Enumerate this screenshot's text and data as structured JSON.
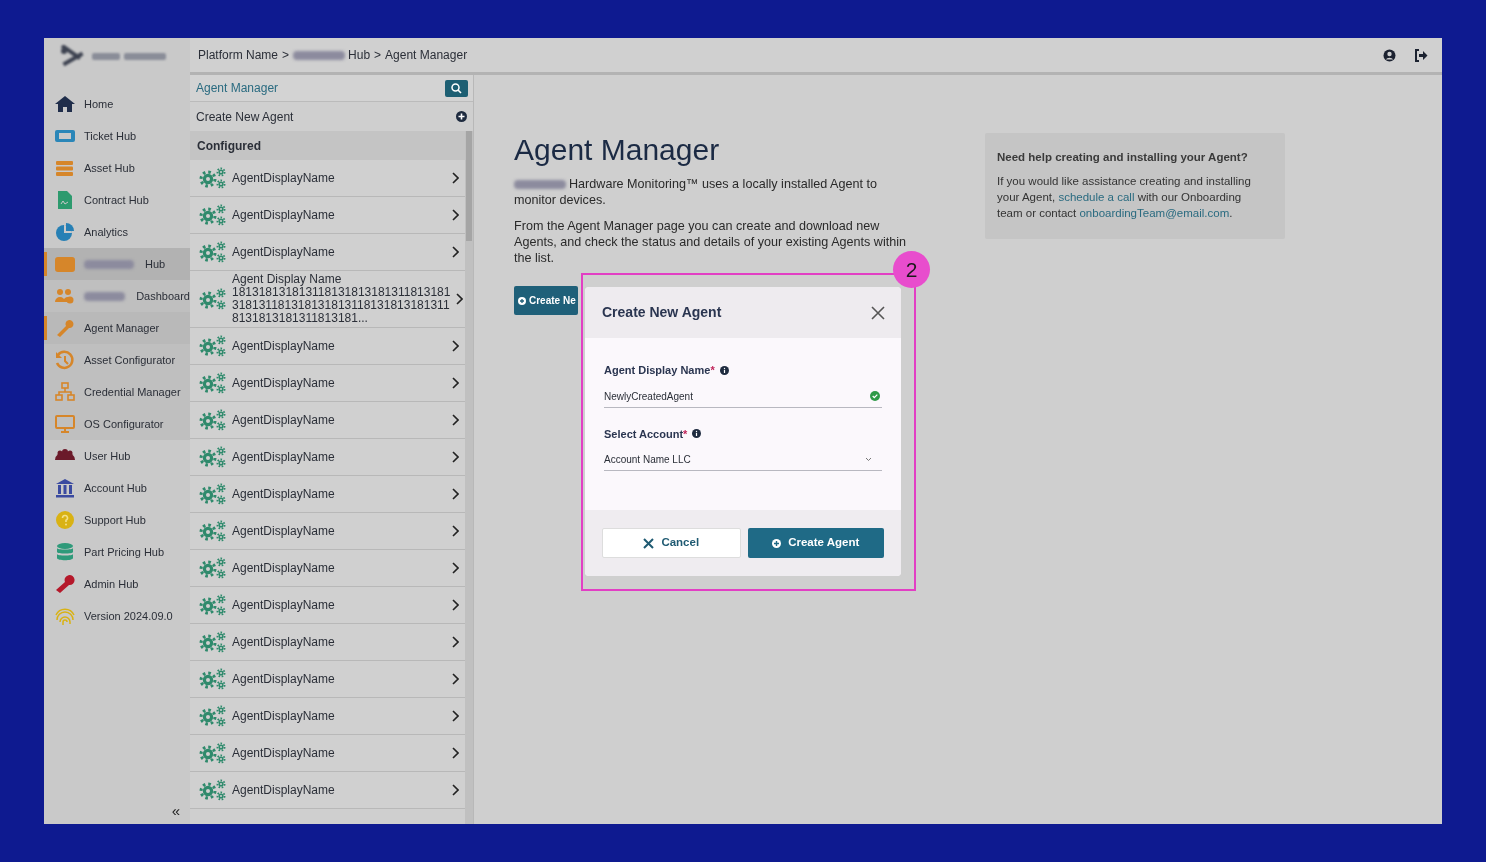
{
  "breadcrumb": {
    "separator": ">",
    "items": [
      {
        "text": "Platform Name",
        "redacted": false
      },
      {
        "text": "Hub",
        "redacted": true
      },
      {
        "text": "Agent Manager",
        "redacted": false
      }
    ]
  },
  "sidebar": {
    "items": [
      {
        "label": "Home",
        "selected": false,
        "redacted": false
      },
      {
        "label": "Ticket Hub",
        "selected": false,
        "redacted": false
      },
      {
        "label": "Asset Hub",
        "selected": false,
        "redacted": false
      },
      {
        "label": "Contract Hub",
        "selected": false,
        "redacted": false
      },
      {
        "label": "Analytics",
        "selected": false,
        "redacted": false
      },
      {
        "label": "Hub",
        "selected": true,
        "redacted": true,
        "children": [
          {
            "label": "Dashboard",
            "selected": false,
            "redacted": true
          },
          {
            "label": "Agent Manager",
            "selected": true,
            "redacted": false
          },
          {
            "label": "Asset Configurator",
            "selected": false,
            "redacted": false
          },
          {
            "label": "Credential Manager",
            "selected": false,
            "redacted": false
          },
          {
            "label": "OS Configurator",
            "selected": false,
            "redacted": false
          }
        ]
      },
      {
        "label": "User Hub",
        "selected": false,
        "redacted": false
      },
      {
        "label": "Account Hub",
        "selected": false,
        "redacted": false
      },
      {
        "label": "Support Hub",
        "selected": false,
        "redacted": false
      },
      {
        "label": "Part Pricing Hub",
        "selected": false,
        "redacted": false
      },
      {
        "label": "Admin Hub",
        "selected": false,
        "redacted": false
      },
      {
        "label": "Version 2024.09.0",
        "selected": false,
        "redacted": false
      }
    ],
    "collapse": "«"
  },
  "agent_list": {
    "search_label": "Agent Manager",
    "create_label": "Create New Agent",
    "section": "Configured",
    "rows": [
      {
        "name": "AgentDisplayName"
      },
      {
        "name": "AgentDisplayName"
      },
      {
        "name": "AgentDisplayName"
      },
      {
        "name": "Agent Display Name\n181318131813118131813181311813181\n318131181318131813118131813181311\n8131813181311813181..."
      },
      {
        "name": "AgentDisplayName"
      },
      {
        "name": "AgentDisplayName"
      },
      {
        "name": "AgentDisplayName"
      },
      {
        "name": "AgentDisplayName"
      },
      {
        "name": "AgentDisplayName"
      },
      {
        "name": "AgentDisplayName"
      },
      {
        "name": "AgentDisplayName"
      },
      {
        "name": "AgentDisplayName"
      },
      {
        "name": "AgentDisplayName"
      },
      {
        "name": "AgentDisplayName"
      },
      {
        "name": "AgentDisplayName"
      },
      {
        "name": "AgentDisplayName"
      },
      {
        "name": "AgentDisplayName"
      }
    ]
  },
  "intro": {
    "title": "Agent Manager",
    "paragraphs": [
      {
        "text": "Hardware Monitoring™ uses a locally installed Agent to monitor devices.",
        "redacted": true
      },
      {
        "text": "From the Agent Manager page you can create and download new Agents, and check the status and details of your existing Agents within the list.",
        "redacted": false
      }
    ],
    "create_button": "Create Ne"
  },
  "help": {
    "title": "Need help creating and installing your Agent?",
    "segments": [
      {
        "kind": "text",
        "text": "If you would like assistance creating and installing your Agent, "
      },
      {
        "kind": "link",
        "text": "schedule a call"
      },
      {
        "kind": "text",
        "text": " with our Onboarding team or contact "
      },
      {
        "kind": "link",
        "text": "onboardingTeam@email.com"
      },
      {
        "kind": "text",
        "text": "."
      }
    ]
  },
  "modal": {
    "title": "Create New Agent",
    "fields": [
      {
        "kind": "text",
        "label": "Agent Display Name",
        "required_mark": "*",
        "value": "NewlyCreatedAgent",
        "valid": true
      },
      {
        "kind": "select",
        "label": "Select Account",
        "required_mark": "*",
        "value": "Account Name LLC"
      }
    ],
    "buttons": [
      {
        "kind": "secondary",
        "label": "Cancel"
      },
      {
        "kind": "primary",
        "label": "Create Agent"
      }
    ]
  },
  "annotation": {
    "label": "2"
  }
}
